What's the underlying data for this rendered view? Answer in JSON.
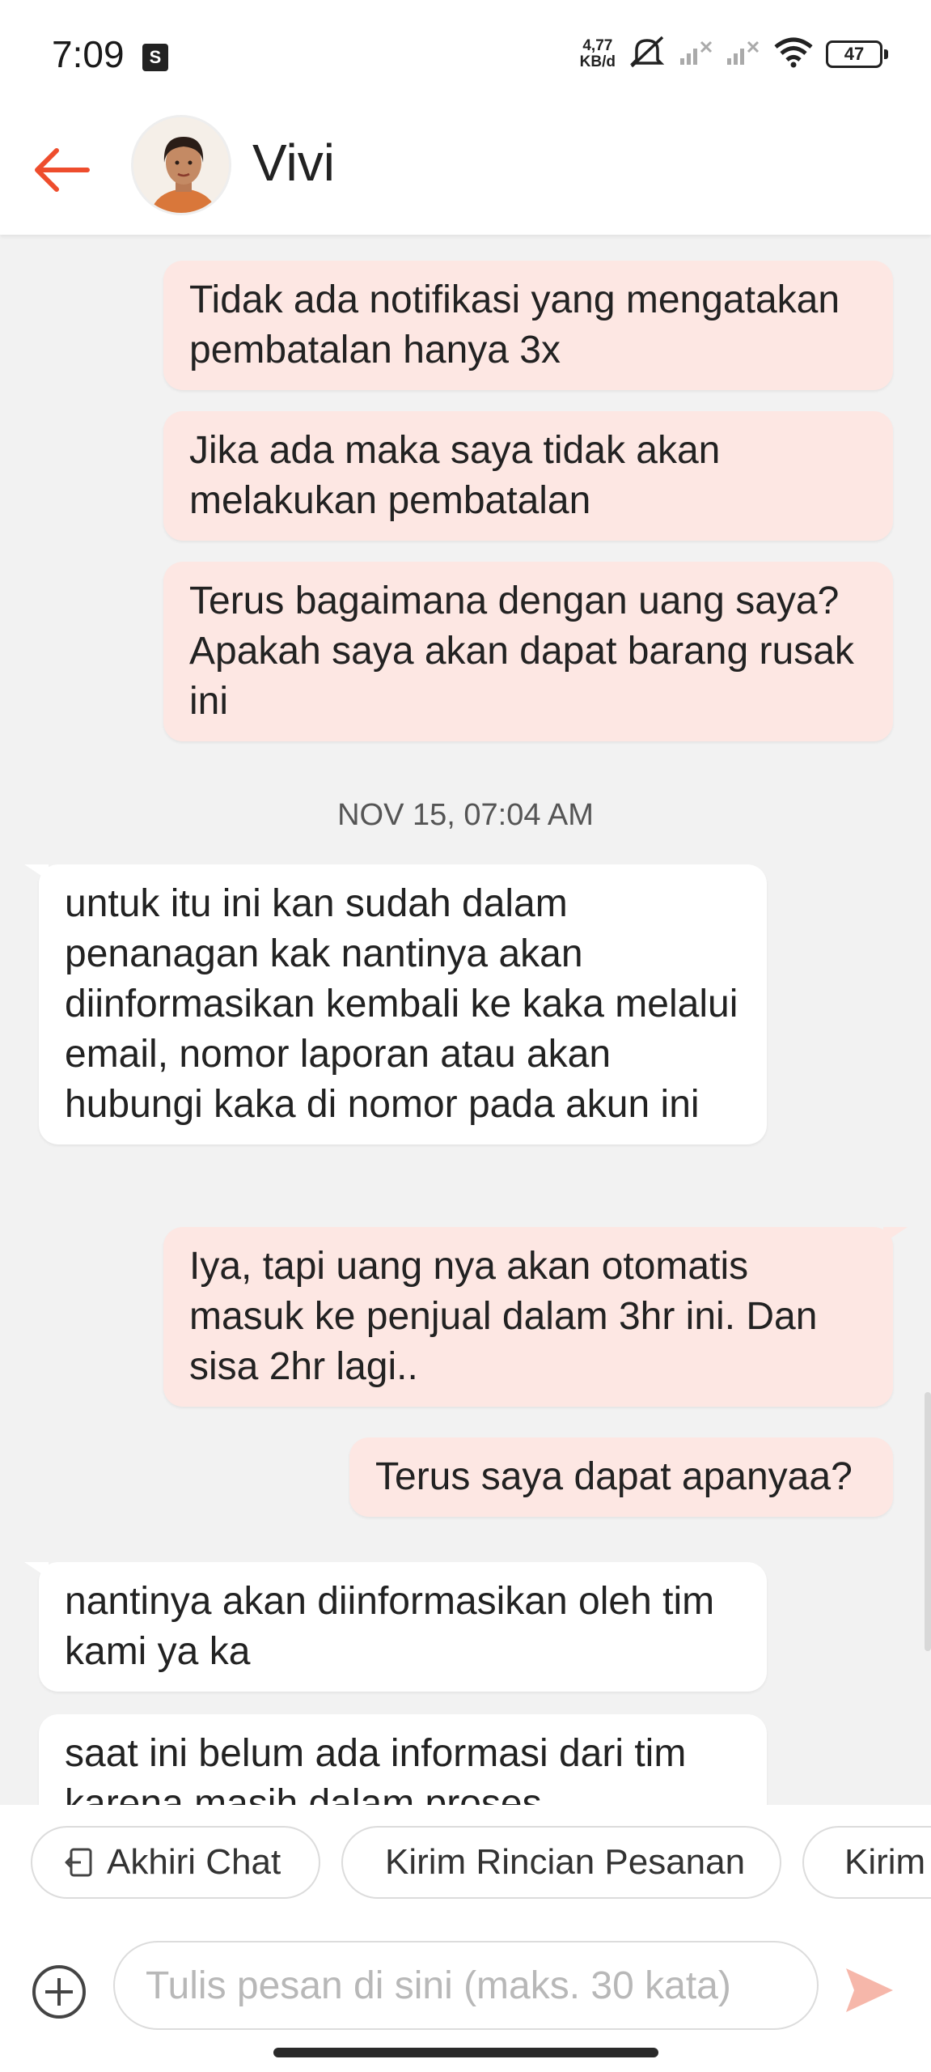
{
  "status_bar": {
    "time": "7:09",
    "network_speed_value": "4,77",
    "network_speed_unit": "KB/d",
    "battery": "47"
  },
  "header": {
    "contact_name": "Vivi"
  },
  "messages": [
    {
      "side": "out",
      "text": "Tidak ada notifikasi yang mengatakan pembatalan hanya 3x"
    },
    {
      "side": "out",
      "text": "Jika ada maka saya tidak akan melakukan pembatalan"
    },
    {
      "side": "out",
      "text": "Terus bagaimana dengan uang saya? Apakah saya akan dapat barang rusak ini"
    },
    {
      "side": "in",
      "text": "untuk itu ini kan sudah dalam penanagan kak nantinya akan diinformasikan kembali ke kaka melalui email, nomor laporan atau akan hubungi kaka di nomor pada akun ini"
    },
    {
      "side": "out",
      "text": "Iya, tapi uang nya akan otomatis masuk ke penjual dalam 3hr ini. Dan sisa 2hr lagi.."
    },
    {
      "side": "out",
      "text": "Terus saya dapat apanyaa?"
    },
    {
      "side": "in",
      "text": "nantinya akan diinformasikan oleh tim kami ya ka"
    },
    {
      "side": "in",
      "text": "saat ini belum ada informasi dari tim karena masih dalam proses"
    }
  ],
  "timestamp": "NOV 15, 07:04 AM",
  "quick_replies": {
    "end_chat": "Akhiri Chat",
    "send_order_details": "Kirim Rincian Pesanan",
    "send_more": "Kirim"
  },
  "composer": {
    "placeholder": "Tulis pesan di sini (maks. 30 kata)"
  },
  "colors": {
    "accent": "#ee4d2d",
    "outgoing_bubble": "#fde7e3",
    "incoming_bubble": "#ffffff",
    "chat_background": "#f2f2f2"
  }
}
